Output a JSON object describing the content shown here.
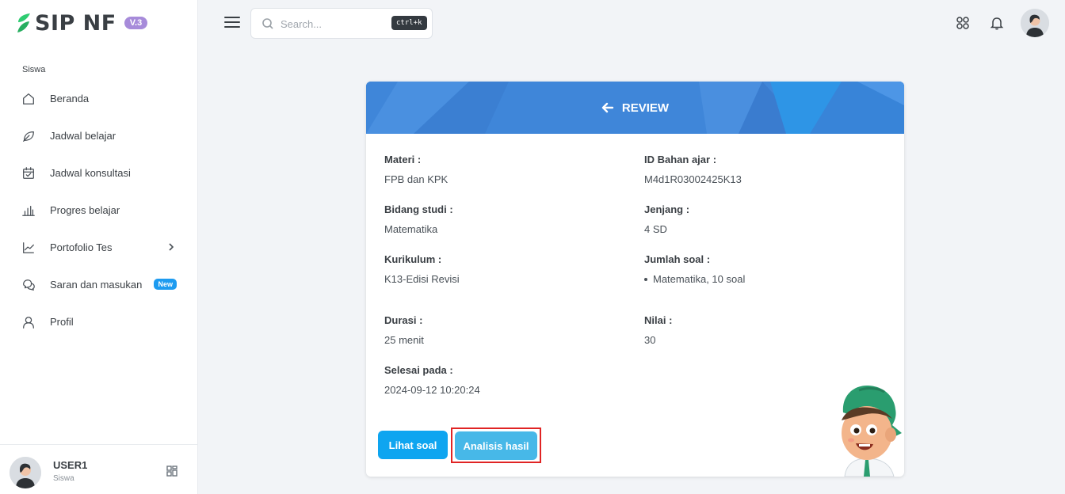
{
  "brand": {
    "name": "SIP NF",
    "version": "V.3"
  },
  "sidebar": {
    "section": "Siswa",
    "items": [
      {
        "label": "Beranda",
        "icon": "home-icon"
      },
      {
        "label": "Jadwal belajar",
        "icon": "leaf-icon"
      },
      {
        "label": "Jadwal konsultasi",
        "icon": "calendar-check-icon"
      },
      {
        "label": "Progres belajar",
        "icon": "bar-chart-icon"
      },
      {
        "label": "Portofolio Tes",
        "icon": "line-chart-icon"
      },
      {
        "label": "Saran dan masukan",
        "icon": "chat-icon",
        "badge": "New"
      },
      {
        "label": "Profil",
        "icon": "user-icon"
      }
    ]
  },
  "user": {
    "name": "USER1",
    "role": "Siswa"
  },
  "search": {
    "placeholder": "Search...",
    "shortcut": "ctrl+k"
  },
  "card": {
    "title": "REVIEW",
    "fields": {
      "materi": {
        "label": "Materi :",
        "value": "FPB dan KPK"
      },
      "id_bahan": {
        "label": "ID Bahan ajar :",
        "value": "M4d1R03002425K13"
      },
      "bidang": {
        "label": "Bidang studi :",
        "value": "Matematika"
      },
      "jenjang": {
        "label": "Jenjang :",
        "value": "4 SD"
      },
      "kurikulum": {
        "label": "Kurikulum :",
        "value": "K13-Edisi Revisi"
      },
      "jumlah": {
        "label": "Jumlah soal :",
        "items": [
          "Matematika, 10 soal"
        ]
      },
      "durasi": {
        "label": "Durasi :",
        "value": "25 menit"
      },
      "nilai": {
        "label": "Nilai :",
        "value": "30"
      },
      "selesai": {
        "label": "Selesai pada :",
        "value": "2024-09-12 10:20:24"
      }
    },
    "buttons": {
      "lihat_soal": "Lihat soal",
      "analisis": "Analisis hasil"
    }
  },
  "colors": {
    "header": "#3f86d9",
    "primary_button": "#0ea5f0",
    "secondary_button": "#47b8e8",
    "badge": "#1d9bf0",
    "version_badge": "#a78bda",
    "highlight": "#e02424"
  }
}
